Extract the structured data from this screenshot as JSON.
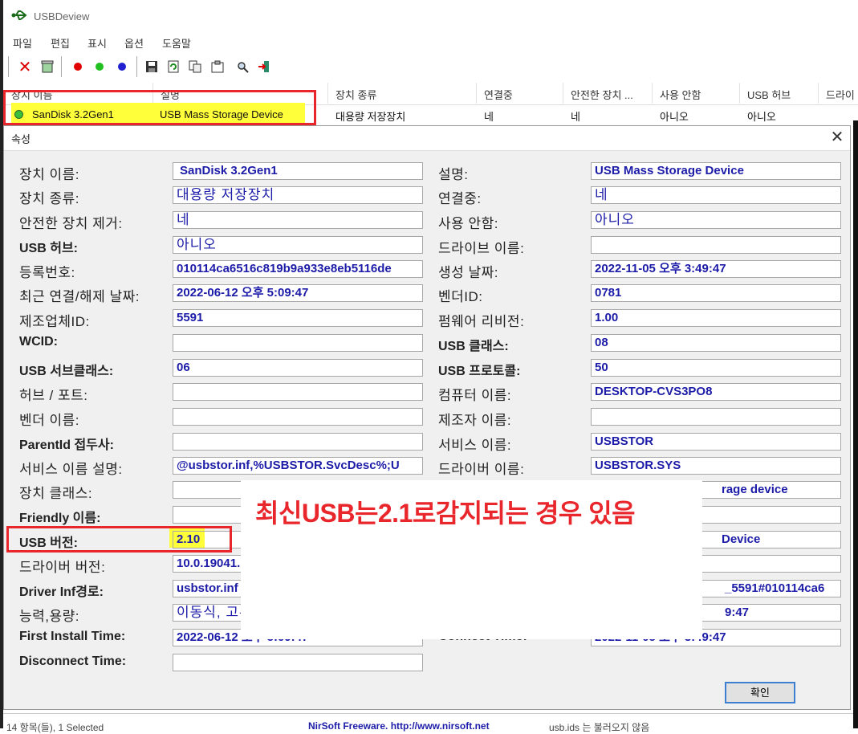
{
  "window": {
    "title": "USBDeview"
  },
  "menu": [
    "파일",
    "편집",
    "표시",
    "옵션",
    "도움말"
  ],
  "toolbar": {
    "icons": [
      "delete-icon",
      "uninstall-icon",
      "red-dot-icon",
      "green-dot-icon",
      "blue-dot-icon",
      "save-icon",
      "refresh-icon",
      "copy-icon",
      "properties-icon",
      "find-icon",
      "exit-icon"
    ],
    "colors": {
      "red": "#e00000",
      "green": "#20c020",
      "blue": "#2020d0"
    }
  },
  "list": {
    "columns": [
      "장치 이름",
      "설명",
      "장치 종류",
      "연결중",
      "안전한 장치 ...",
      "사용 안함",
      "USB 허브",
      "드라이"
    ],
    "row": [
      "SanDisk 3.2Gen1",
      "USB Mass Storage Device",
      "대용량 저장장치",
      "네",
      "네",
      "아니오",
      "아니오"
    ]
  },
  "dialog": {
    "title": "속성",
    "left": [
      {
        "label": "장치 이름:",
        "value": "SanDisk 3.2Gen1"
      },
      {
        "label": "장치 종류:",
        "value": "대용량 저장장치"
      },
      {
        "label": "안전한 장치 제거:",
        "value": "네"
      },
      {
        "label": "USB 허브:",
        "value": "아니오"
      },
      {
        "label": "등록번호:",
        "value": "010114ca6516c819b9a933e8eb5116de"
      },
      {
        "label": "최근 연결/해제 날짜:",
        "value": "2022-06-12 오후 5:09:47"
      },
      {
        "label": "제조업체ID:",
        "value": "5591"
      },
      {
        "label": "WCID:",
        "value": ""
      },
      {
        "label": "USB 서브클래스:",
        "value": "06"
      },
      {
        "label": "허브 / 포트:",
        "value": ""
      },
      {
        "label": "벤더 이름:",
        "value": ""
      },
      {
        "label": "ParentId 접두사:",
        "value": ""
      },
      {
        "label": "서비스 이름 설명:",
        "value": "@usbstor.inf,%USBSTOR.SvcDesc%;U"
      },
      {
        "label": "장치 클래스:",
        "value": ""
      },
      {
        "label": "Friendly 이름:",
        "value": ""
      },
      {
        "label": "USB 버전:",
        "value": "2.10"
      },
      {
        "label": "드라이버 버전:",
        "value": "10.0.19041.1"
      },
      {
        "label": "Driver Inf경로:",
        "value": "usbstor.inf"
      },
      {
        "label": "능력,용량:",
        "value": "이동식, 고유"
      },
      {
        "label": "First Install Time:",
        "value": "2022-06-12 오후 5:09:47"
      },
      {
        "label": "Disconnect Time:",
        "value": ""
      }
    ],
    "right": [
      {
        "label": "설명:",
        "value": "USB Mass Storage Device"
      },
      {
        "label": "연결중:",
        "value": "네"
      },
      {
        "label": "사용 안함:",
        "value": "아니오"
      },
      {
        "label": "드라이브 이름:",
        "value": ""
      },
      {
        "label": "생성 날짜:",
        "value": "2022-11-05 오후 3:49:47"
      },
      {
        "label": "벤더ID:",
        "value": "0781"
      },
      {
        "label": "펌웨어 리비전:",
        "value": "1.00"
      },
      {
        "label": "USB 클래스:",
        "value": "08"
      },
      {
        "label": "USB 프로토콜:",
        "value": "50"
      },
      {
        "label": "컴퓨터 이름:",
        "value": "DESKTOP-CVS3PO8"
      },
      {
        "label": "제조자 이름:",
        "value": ""
      },
      {
        "label": "서비스 이름:",
        "value": "USBSTOR"
      },
      {
        "label": "드라이버 이름:",
        "value": "USBSTOR.SYS"
      },
      {
        "label": "",
        "value": "rage device"
      },
      {
        "label": "",
        "value": ""
      },
      {
        "label": "",
        "value": "Device"
      },
      {
        "label": "",
        "value": ""
      },
      {
        "label": "",
        "value": "_5591#010114ca6"
      },
      {
        "label": "",
        "value": "9:47"
      },
      {
        "label": "Connect Time:",
        "value": "2022-11-05 오후 3:49:47"
      }
    ],
    "ok_label": "확인"
  },
  "annotation": "최신USB는2.1로감지되는 경우 있음",
  "status": {
    "count": "14 항목(들), 1 Selected",
    "nirsoft": "NirSoft Freeware.  http://www.nirsoft.net",
    "usbids": "usb.ids 는 불러오지 않음"
  }
}
